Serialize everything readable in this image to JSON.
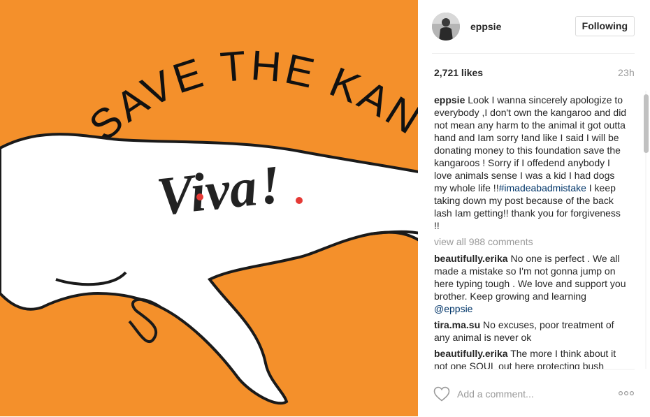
{
  "photo": {
    "arc_text": "SAVE THE KAN",
    "logo_text": "Viva",
    "logo_bang": "!",
    "background_color": "#f4902b"
  },
  "post": {
    "username": "eppsie",
    "follow_label": "Following",
    "likes": "2,721 likes",
    "time": "23h",
    "caption": {
      "user": "eppsie",
      "text_before": "Look I wanna sincerely apologize to everybody ,I don't own the kangaroo and did not mean any harm to the animal it got outta hand and Iam sorry !and like I said I will be donating money to this foundation save the kangaroos ! Sorry if I offedend anybody I love animals sense I was a kid I had dogs my whole life !!",
      "hashtag": "#imadeabadmistake",
      "text_after": " I keep taking down my post because of the back lash Iam getting!! thank you for forgiveness !!"
    },
    "view_all": "view all 988 comments",
    "comments": [
      {
        "user": "beautifully.erika",
        "text": "No one is perfect . We all made a mistake so I'm not gonna jump on here typing tough . We love and support you brother. Keep growing and learning ",
        "mention": "@eppsie"
      },
      {
        "user": "tira.ma.su",
        "text": "No excuses, poor treatment of any animal is never ok",
        "mention": ""
      },
      {
        "user": "beautifully.erika",
        "text": "The more I think about it not one SOUL out here protecting bush",
        "mention": ""
      }
    ],
    "add_comment_placeholder": "Add a comment...",
    "icons": {
      "like": "heart-outline-icon",
      "more": "ellipsis-icon"
    }
  }
}
